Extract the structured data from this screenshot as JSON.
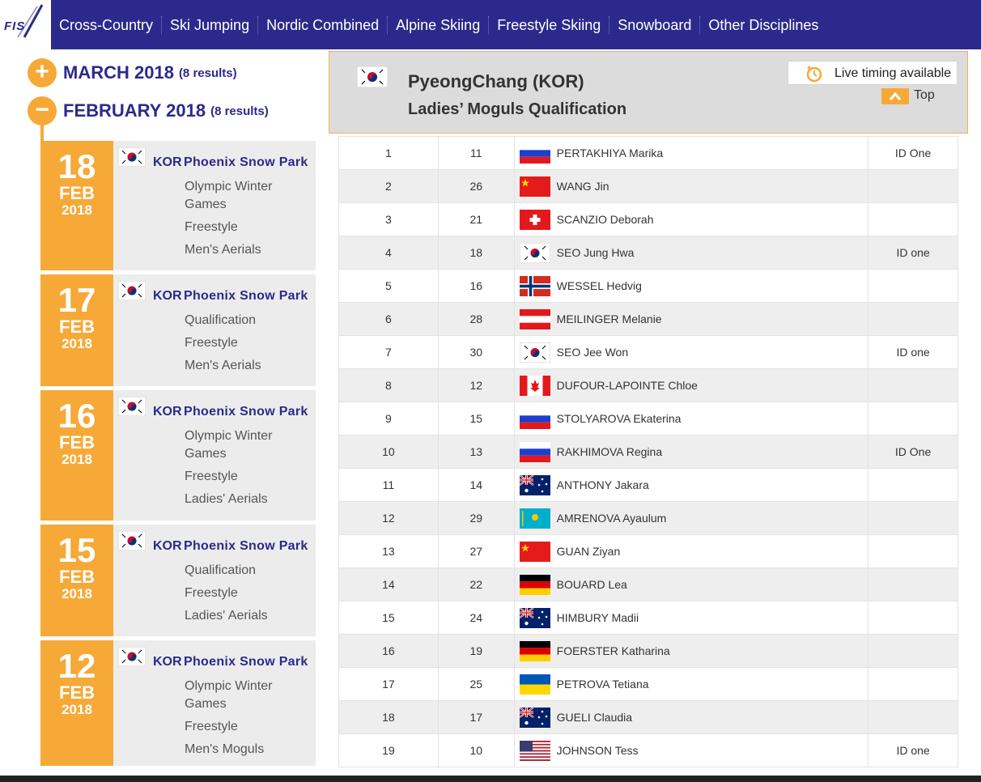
{
  "nav": {
    "logo": "FIS",
    "items": [
      "Cross-Country",
      "Ski Jumping",
      "Nordic Combined",
      "Alpine Skiing",
      "Freestyle Skiing",
      "Snowboard",
      "Other Disciplines"
    ]
  },
  "months": [
    {
      "label": "MARCH 2018",
      "count": "(8 results)",
      "toggle": "+"
    },
    {
      "label": "FEBRUARY 2018",
      "count": "(8 results)",
      "toggle": "−"
    }
  ],
  "events": [
    {
      "day": "18",
      "month": "FEB",
      "year": "2018",
      "nation": "KOR",
      "place": "Phoenix Snow Park",
      "details": [
        "Olympic Winter Games",
        "Freestyle",
        "Men's Aerials"
      ]
    },
    {
      "day": "17",
      "month": "FEB",
      "year": "2018",
      "nation": "KOR",
      "place": "Phoenix Snow Park",
      "details": [
        "Qualification",
        "Freestyle",
        "Men's Aerials"
      ]
    },
    {
      "day": "16",
      "month": "FEB",
      "year": "2018",
      "nation": "KOR",
      "place": "Phoenix Snow Park",
      "details": [
        "Olympic Winter Games",
        "Freestyle",
        "Ladies' Aerials"
      ]
    },
    {
      "day": "15",
      "month": "FEB",
      "year": "2018",
      "nation": "KOR",
      "place": "Phoenix Snow Park",
      "details": [
        "Qualification",
        "Freestyle",
        "Ladies' Aerials"
      ]
    },
    {
      "day": "12",
      "month": "FEB",
      "year": "2018",
      "nation": "KOR",
      "place": "Phoenix Snow Park",
      "details": [
        "Olympic Winter Games",
        "Freestyle",
        "Men's Moguls"
      ]
    }
  ],
  "header": {
    "title": "PyeongChang (KOR)",
    "subtitle": "Ladies’ Moguls Qualification",
    "live_label": "Live timing available",
    "top_label": "Top"
  },
  "results": [
    {
      "rank": "1",
      "bib": "11",
      "flag": "RUS",
      "name": "PERTAKHIYA Marika",
      "note": "ID One"
    },
    {
      "rank": "2",
      "bib": "26",
      "flag": "CHN",
      "name": "WANG Jin",
      "note": ""
    },
    {
      "rank": "3",
      "bib": "21",
      "flag": "SUI",
      "name": "SCANZIO Deborah",
      "note": ""
    },
    {
      "rank": "4",
      "bib": "18",
      "flag": "KOR",
      "name": "SEO Jung Hwa",
      "note": "ID one"
    },
    {
      "rank": "5",
      "bib": "16",
      "flag": "NOR",
      "name": "WESSEL Hedvig",
      "note": ""
    },
    {
      "rank": "6",
      "bib": "28",
      "flag": "AUT",
      "name": "MEILINGER Melanie",
      "note": ""
    },
    {
      "rank": "7",
      "bib": "30",
      "flag": "KOR",
      "name": "SEO Jee Won",
      "note": "ID one"
    },
    {
      "rank": "8",
      "bib": "12",
      "flag": "CAN",
      "name": "DUFOUR-LAPOINTE Chloe",
      "note": ""
    },
    {
      "rank": "9",
      "bib": "15",
      "flag": "RUS",
      "name": "STOLYAROVA Ekaterina",
      "note": ""
    },
    {
      "rank": "10",
      "bib": "13",
      "flag": "RUS",
      "name": "RAKHIMOVA Regina",
      "note": "ID One"
    },
    {
      "rank": "11",
      "bib": "14",
      "flag": "AUS",
      "name": "ANTHONY Jakara",
      "note": ""
    },
    {
      "rank": "12",
      "bib": "29",
      "flag": "KAZ",
      "name": "AMRENOVA Ayaulum",
      "note": ""
    },
    {
      "rank": "13",
      "bib": "27",
      "flag": "CHN",
      "name": "GUAN Ziyan",
      "note": ""
    },
    {
      "rank": "14",
      "bib": "22",
      "flag": "GER",
      "name": "BOUARD Lea",
      "note": ""
    },
    {
      "rank": "15",
      "bib": "24",
      "flag": "AUS",
      "name": "HIMBURY Madii",
      "note": ""
    },
    {
      "rank": "16",
      "bib": "19",
      "flag": "GER",
      "name": "FOERSTER Katharina",
      "note": ""
    },
    {
      "rank": "17",
      "bib": "25",
      "flag": "UKR",
      "name": "PETROVA Tetiana",
      "note": ""
    },
    {
      "rank": "18",
      "bib": "17",
      "flag": "AUS",
      "name": "GUELI Claudia",
      "note": ""
    },
    {
      "rank": "19",
      "bib": "10",
      "flag": "USA",
      "name": "JOHNSON Tess",
      "note": "ID one"
    }
  ],
  "colors": {
    "brand": "#2b2a8c",
    "accent": "#f6a937"
  }
}
